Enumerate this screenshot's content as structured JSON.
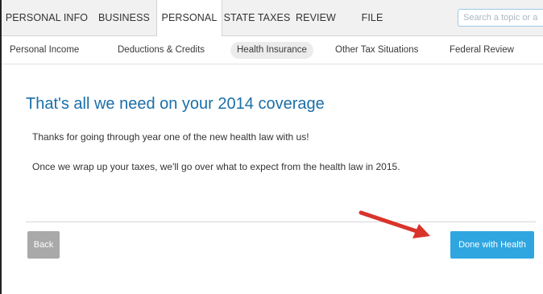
{
  "top_nav": {
    "tabs": [
      {
        "label": "PERSONAL INFO",
        "active": false
      },
      {
        "label": "BUSINESS",
        "active": false
      },
      {
        "label": "PERSONAL",
        "active": true
      },
      {
        "label": "STATE TAXES",
        "active": false
      },
      {
        "label": "REVIEW",
        "active": false
      },
      {
        "label": "FILE",
        "active": false
      }
    ],
    "search_placeholder": "Search a topic or a"
  },
  "sub_nav": {
    "items": [
      {
        "label": "Personal Income",
        "active": false
      },
      {
        "label": "Deductions & Credits",
        "active": false
      },
      {
        "label": "Health Insurance",
        "active": true
      },
      {
        "label": "Other Tax Situations",
        "active": false
      },
      {
        "label": "Federal Review",
        "active": false
      }
    ]
  },
  "main": {
    "heading": "That's all we need on your 2014 coverage",
    "paragraph_1": "Thanks for going through year one of the new health law with us!",
    "paragraph_2": "Once we wrap up your taxes, we'll go over what to expect from the health law in 2015."
  },
  "buttons": {
    "back_label": "Back",
    "done_label": "Done with Health"
  },
  "colors": {
    "heading": "#1a6fa8",
    "primary_button": "#2fa6e0",
    "back_button": "#a9a9a9",
    "annotation_arrow": "#d9342b"
  },
  "icons": {
    "annotation": "red-arrow-icon"
  }
}
